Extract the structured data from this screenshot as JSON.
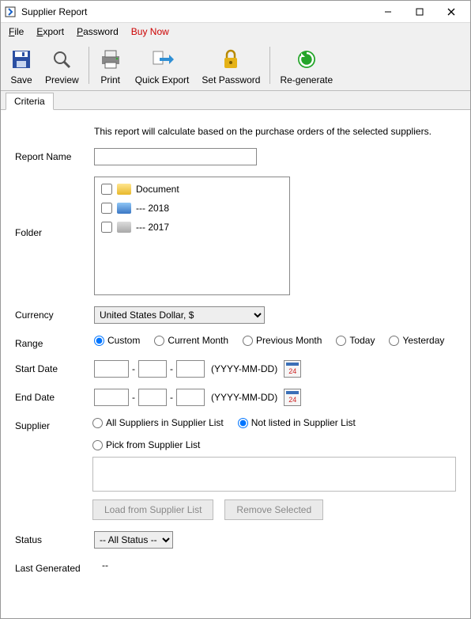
{
  "window": {
    "title": "Supplier Report"
  },
  "menu": {
    "file": "File",
    "export": "Export",
    "password": "Password",
    "buy_now": "Buy Now"
  },
  "toolbar": {
    "save": "Save",
    "preview": "Preview",
    "print": "Print",
    "quick_export": "Quick Export",
    "set_password": "Set Password",
    "re_generate": "Re-generate"
  },
  "tabs": {
    "criteria": "Criteria"
  },
  "intro": "This report will calculate based on the purchase orders of the selected suppliers.",
  "labels": {
    "report_name": "Report Name",
    "folder": "Folder",
    "currency": "Currency",
    "range": "Range",
    "start_date": "Start Date",
    "end_date": "End Date",
    "supplier": "Supplier",
    "status": "Status",
    "last_generated": "Last Generated"
  },
  "report_name_value": "",
  "folders": [
    {
      "label": "Document",
      "color": "yellow"
    },
    {
      "label": "--- 2018",
      "color": "blue"
    },
    {
      "label": "--- 2017",
      "color": "gray"
    }
  ],
  "currency": {
    "selected": "United States Dollar, $"
  },
  "range": {
    "options": [
      "Custom",
      "Current Month",
      "Previous Month",
      "Today",
      "Yesterday"
    ],
    "selected": "Custom"
  },
  "date_hint": "(YYYY-MM-DD)",
  "cal_day": "24",
  "supplier": {
    "options": [
      "All Suppliers in Supplier List",
      "Not listed in Supplier List",
      "Pick from Supplier List"
    ],
    "selected": "Not listed in Supplier List"
  },
  "buttons": {
    "load": "Load from Supplier List",
    "remove": "Remove Selected"
  },
  "status": {
    "selected": "-- All Status --"
  },
  "last_generated_value": "--"
}
